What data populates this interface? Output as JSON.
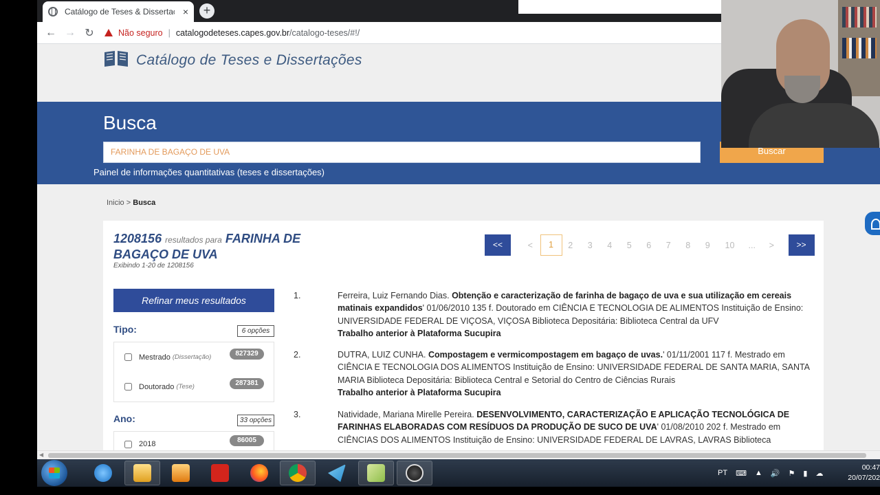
{
  "browser": {
    "tab_title": "Catálogo de Teses & Dissertaçõ",
    "tab_close": "×",
    "new_tab": "+",
    "not_secure": "Não seguro",
    "url_host": "catalogodeteses.capes.gov.br",
    "url_path": "/catalogo-teses/#!/"
  },
  "header": {
    "logo_text": "Catálogo de Teses e Dissertações"
  },
  "search": {
    "title": "Busca",
    "query": "FARINHA DE BAGAÇO DE UVA",
    "button": "Buscar",
    "panel_link": "Painel de informações quantitativas (teses e dissertações)"
  },
  "breadcrumb": {
    "home": "Inicio",
    "sep": ">",
    "current": "Busca"
  },
  "summary": {
    "count": "1208156",
    "results_for": "resultados para",
    "term": "FARINHA DE BAGAÇO DE UVA",
    "showing": "Exibindo 1-20 de 1208156"
  },
  "pagination": {
    "first": "<<",
    "prev": "<",
    "pages": [
      "1",
      "2",
      "3",
      "4",
      "5",
      "6",
      "7",
      "8",
      "9",
      "10"
    ],
    "ellipsis": "...",
    "next": ">",
    "last": ">>"
  },
  "refine": {
    "button": "Refinar meus resultados",
    "tipo": {
      "label": "Tipo:",
      "options": "6 opções",
      "items": [
        {
          "label": "Mestrado",
          "sub": "(Dissertação)",
          "count": "827329"
        },
        {
          "label": "Doutorado",
          "sub": "(Tese)",
          "count": "287381"
        }
      ]
    },
    "ano": {
      "label": "Ano:",
      "options": "33 opções",
      "items": [
        {
          "label": "2018",
          "count": "86005"
        }
      ]
    }
  },
  "results": [
    {
      "num": "1.",
      "author": "Ferreira, Luiz Fernando Dias.",
      "title": "Obtenção e caracterização de farinha de bagaço de uva e sua utilização em cereais matinais expandidos",
      "details": "' 01/06/2010 135 f. Doutorado em CIÊNCIA E TECNOLOGIA DE ALIMENTOS Instituição de Ensino: UNIVERSIDADE FEDERAL DE VIÇOSA, VIÇOSA Biblioteca Depositária: Biblioteca Central da UFV",
      "prev": "Trabalho anterior à Plataforma Sucupira"
    },
    {
      "num": "2.",
      "author": "DUTRA, LUIZ CUNHA.",
      "title": "Compostagem e vermicompostagem em bagaço de uvas.",
      "details": "' 01/11/2001 117 f. Mestrado em CIÊNCIA E TECNOLOGIA DOS ALIMENTOS Instituição de Ensino: UNIVERSIDADE FEDERAL DE SANTA MARIA, SANTA MARIA Biblioteca Depositária: Biblioteca Central e Setorial do Centro de Ciências Rurais",
      "prev": "Trabalho anterior à Plataforma Sucupira"
    },
    {
      "num": "3.",
      "author": "Natividade, Mariana Mirelle Pereira.",
      "title": "DESENVOLVIMENTO, CARACTERIZAÇÃO E APLICAÇÃO TECNOLÓGICA DE FARINHAS ELABORADAS COM RESÍDUOS DA PRODUÇÃO DE SUCO DE UVA",
      "details": "' 01/08/2010 202 f. Mestrado em CIÊNCIAS DOS ALIMENTOS Instituição de Ensino: UNIVERSIDADE FEDERAL DE LAVRAS, LAVRAS Biblioteca",
      "prev": ""
    }
  ],
  "taskbar": {
    "lang": "PT",
    "time": "00:47",
    "date": "20/07/202"
  },
  "colors": {
    "band": "#2f5596",
    "accent": "#f0a64b",
    "brand_text": "#3d5a80"
  }
}
